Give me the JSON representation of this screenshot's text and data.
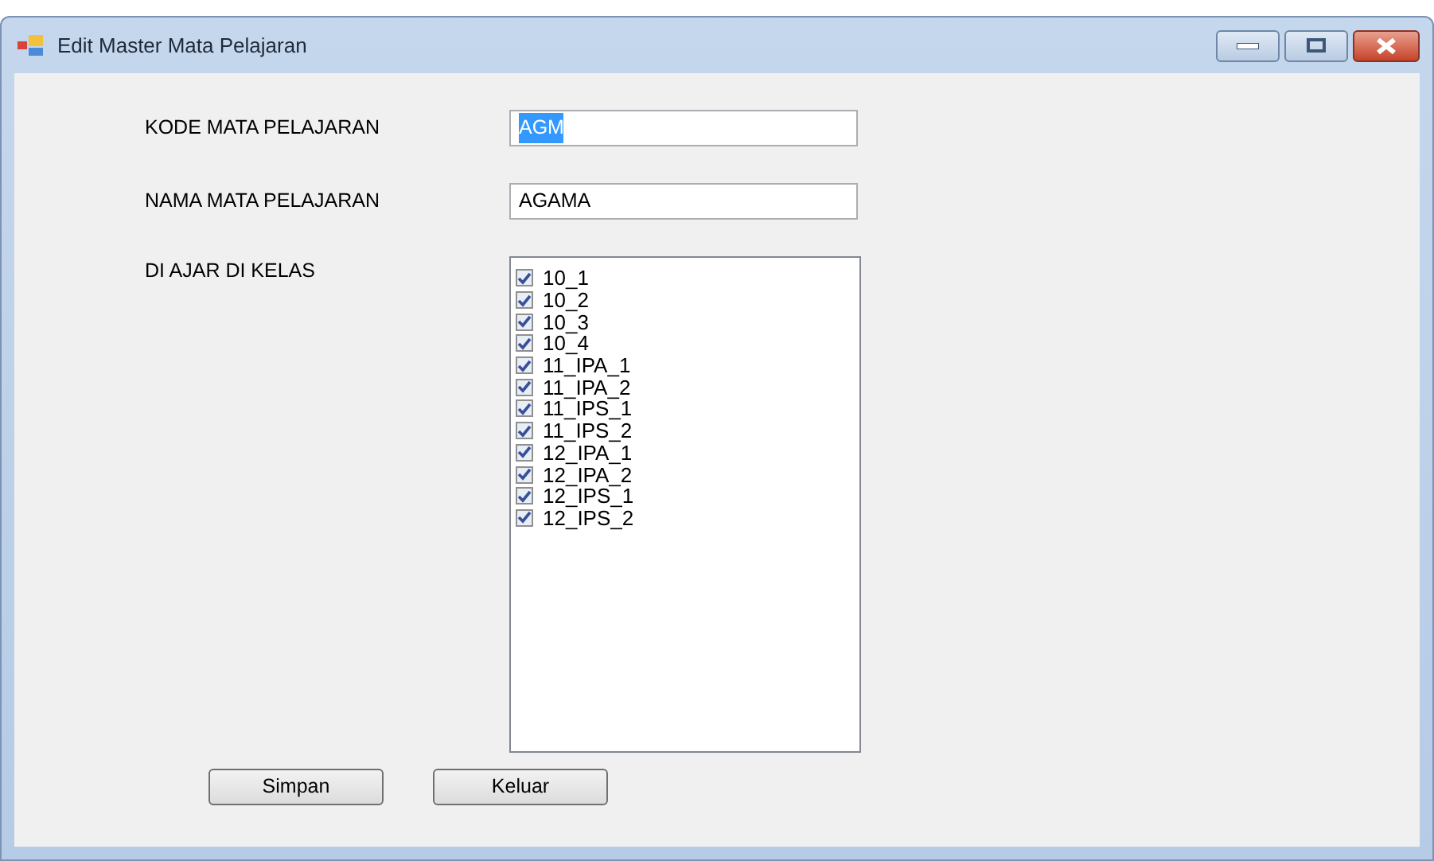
{
  "window": {
    "title": "Edit Master Mata Pelajaran"
  },
  "fields": [
    {
      "label": "KODE MATA PELAJARAN",
      "value": "AGM",
      "text_selected": true
    },
    {
      "label": "NAMA MATA PELAJARAN",
      "value": "AGAMA",
      "text_selected": false
    }
  ],
  "class_list": {
    "label": "DI AJAR DI KELAS",
    "items": [
      {
        "label": "10_1",
        "checked": true
      },
      {
        "label": "10_2",
        "checked": true
      },
      {
        "label": "10_3",
        "checked": true
      },
      {
        "label": "10_4",
        "checked": true
      },
      {
        "label": "11_IPA_1",
        "checked": true
      },
      {
        "label": "11_IPA_2",
        "checked": true
      },
      {
        "label": "11_IPS_1",
        "checked": true
      },
      {
        "label": "11_IPS_2",
        "checked": true
      },
      {
        "label": "12_IPA_1",
        "checked": true
      },
      {
        "label": "12_IPA_2",
        "checked": true
      },
      {
        "label": "12_IPS_1",
        "checked": true
      },
      {
        "label": "12_IPS_2",
        "checked": true
      }
    ]
  },
  "buttons": [
    "Simpan",
    "Keluar"
  ]
}
